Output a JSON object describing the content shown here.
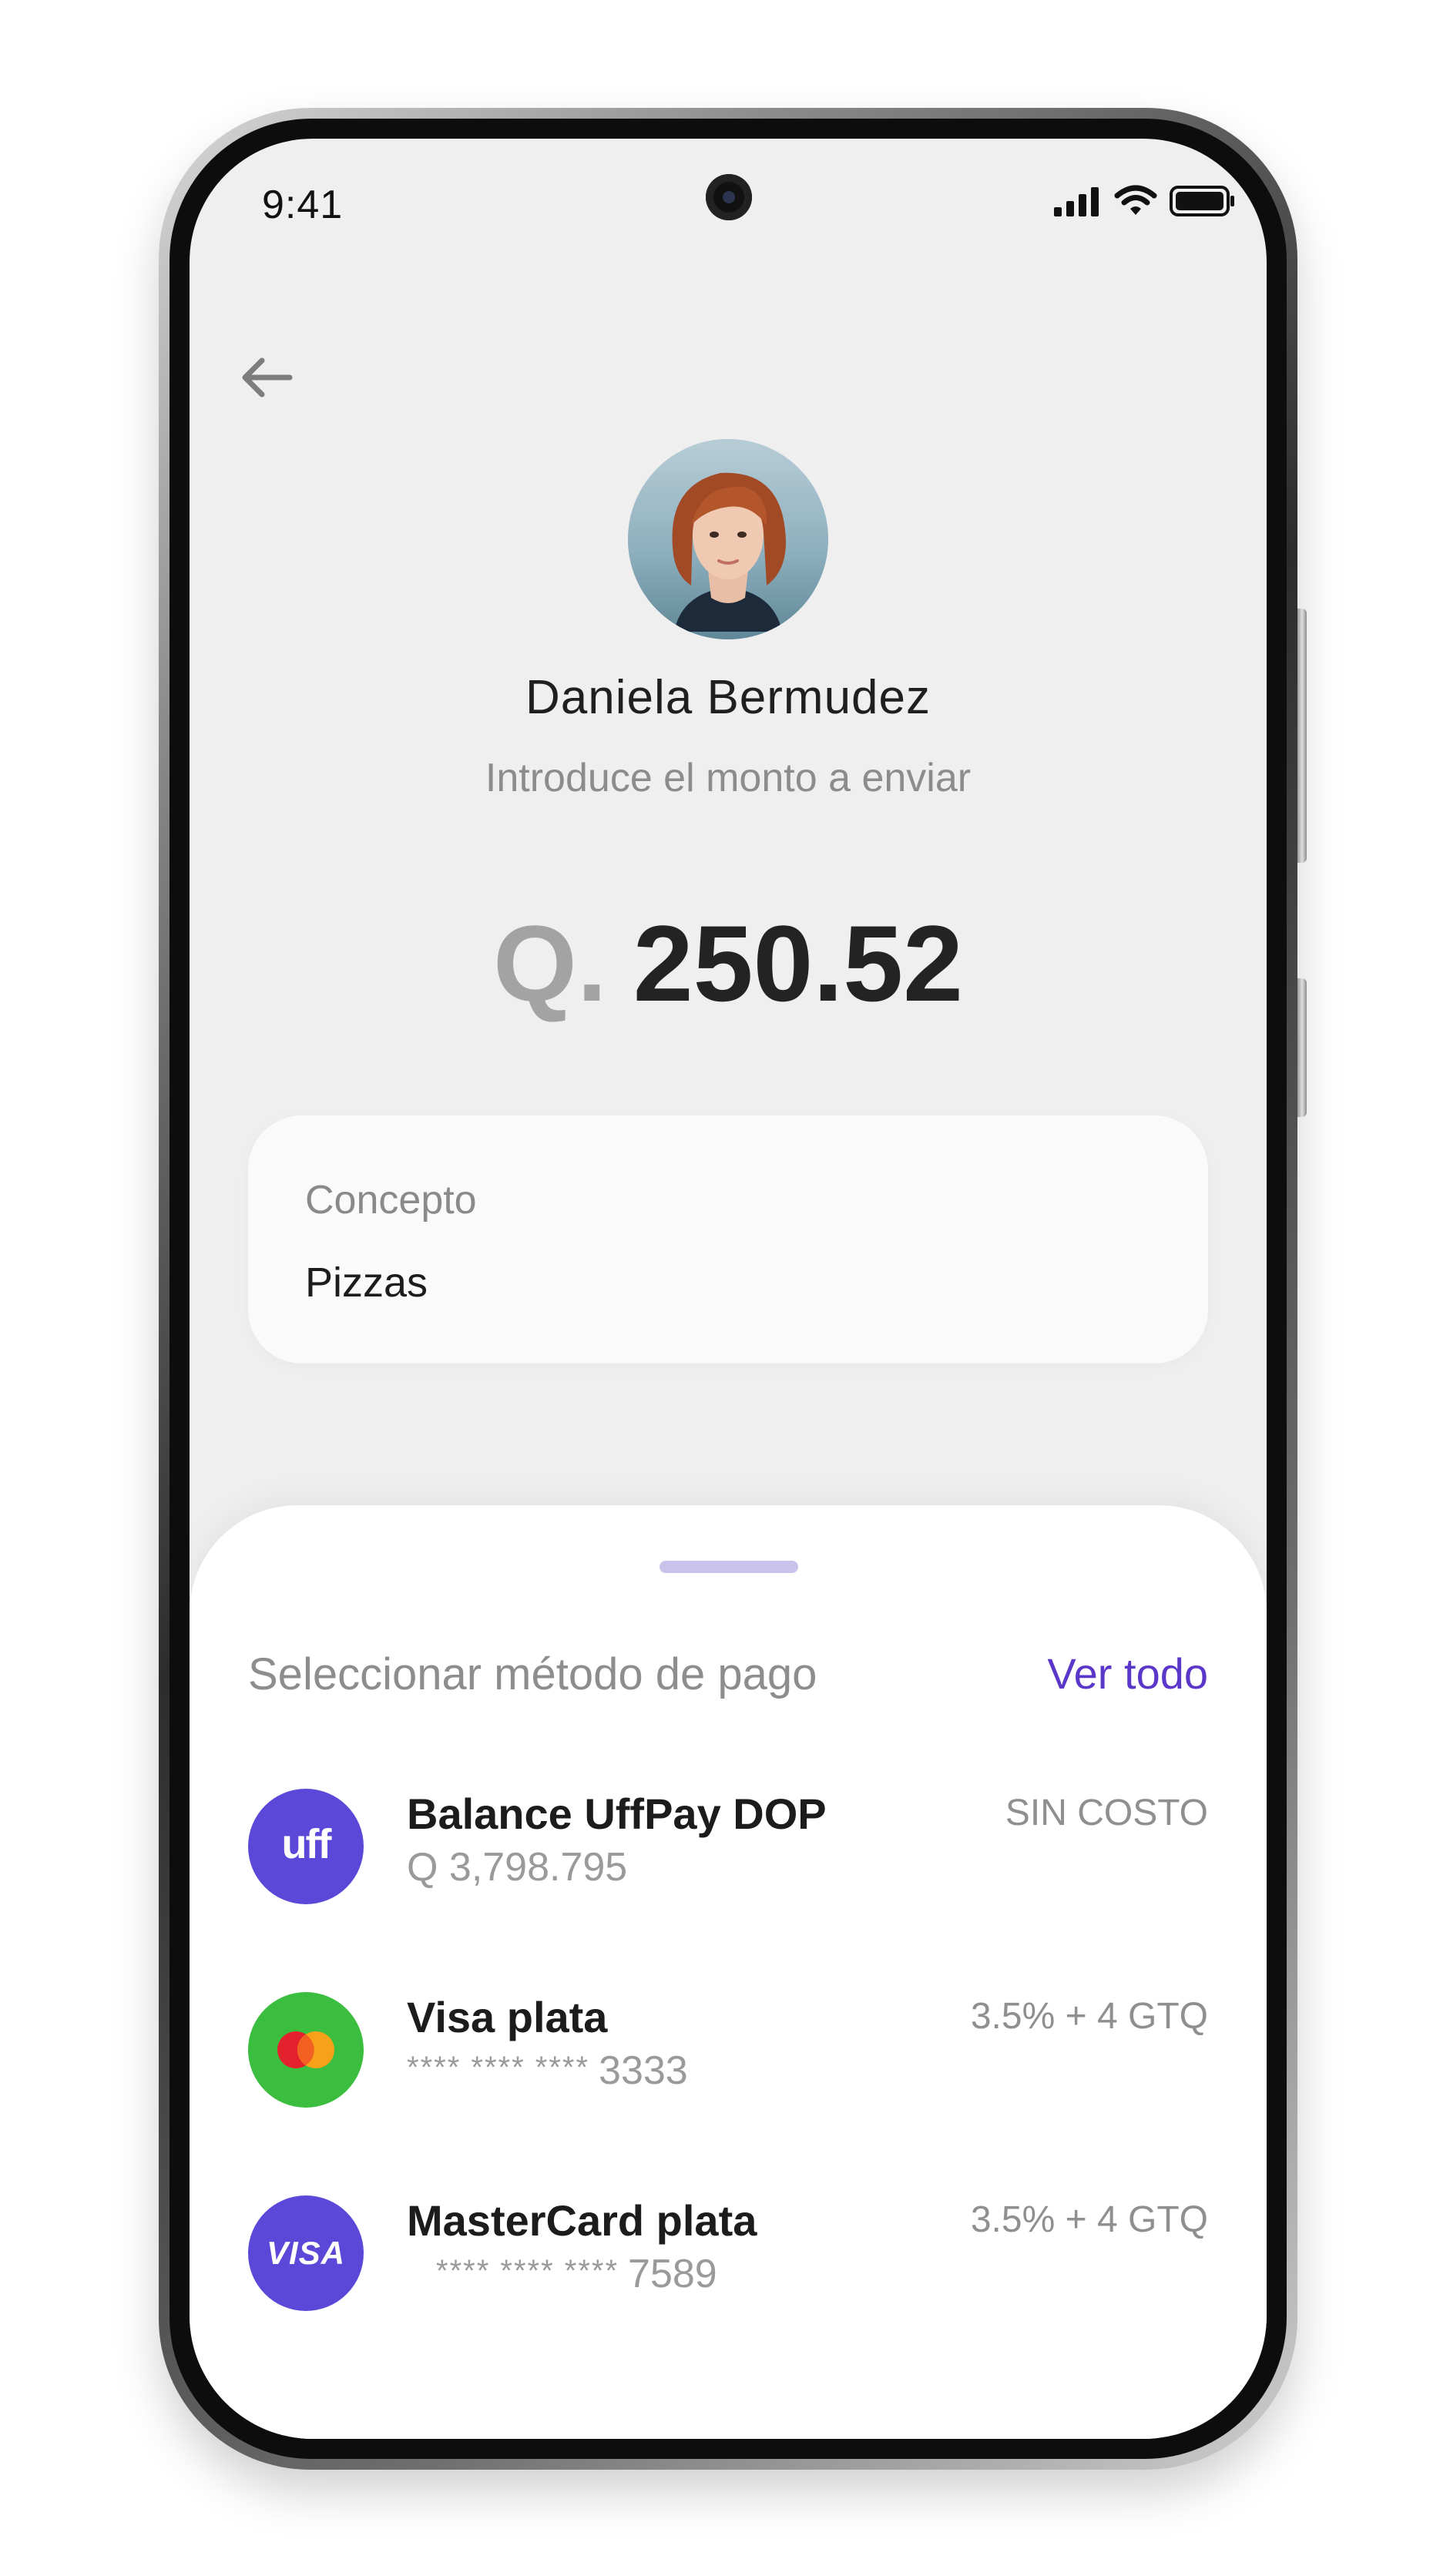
{
  "status_bar": {
    "time": "9:41"
  },
  "contact": {
    "name": "Daniela Bermudez",
    "prompt": "Introduce el monto a enviar"
  },
  "amount": {
    "currency": "Q.",
    "value": "250.52"
  },
  "concept": {
    "label": "Concepto",
    "value": "Pizzas"
  },
  "payment_sheet": {
    "title": "Seleccionar método de pago",
    "see_all": "Ver todo",
    "methods": [
      {
        "icon": "uff-logo-icon",
        "icon_text": "uff",
        "icon_color": "#5b48d8",
        "name": "Balance UffPay DOP",
        "detail": "Q 3,798.795",
        "fee": "SIN COSTO"
      },
      {
        "icon": "mastercard-logo-icon",
        "icon_color": "#3bbd3f",
        "name": "Visa plata",
        "mask": "**** **** ****",
        "last4": "3333",
        "fee": "3.5% + 4 GTQ"
      },
      {
        "icon": "visa-logo-icon",
        "icon_text": "VISA",
        "icon_color": "#5b48d8",
        "name": "MasterCard plata",
        "mask": "**** **** ****",
        "last4": "7589",
        "fee": "3.5% + 4 GTQ"
      }
    ]
  },
  "colors": {
    "accent": "#5a36c9",
    "screen_bg": "#efefef",
    "sheet_bg": "#ffffff"
  }
}
